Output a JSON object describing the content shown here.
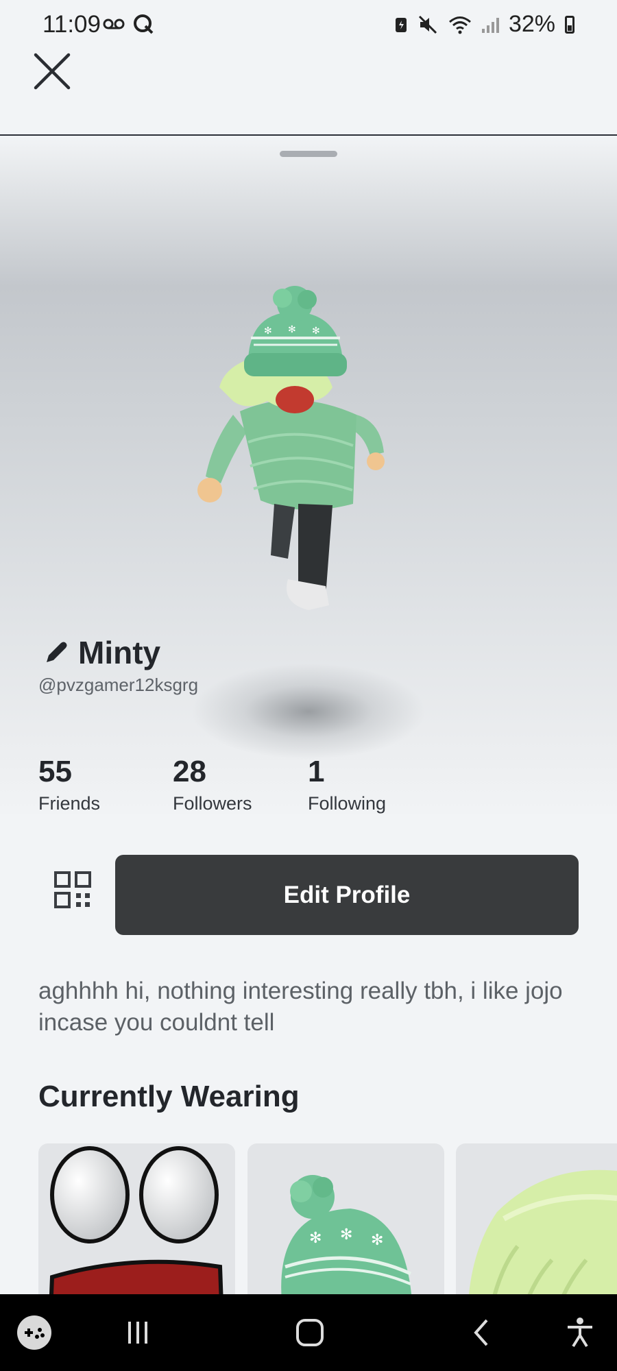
{
  "status_bar": {
    "time": "11:09",
    "battery": "32%"
  },
  "profile": {
    "display_name": "Minty",
    "username": "@pvzgamer12ksgrg",
    "bio": "aghhhh hi, nothing interesting really tbh, i like jojo incase you couldnt tell"
  },
  "stats": [
    {
      "value": "55",
      "label": "Friends"
    },
    {
      "value": "28",
      "label": "Followers"
    },
    {
      "value": "1",
      "label": "Following"
    }
  ],
  "actions": {
    "edit_profile": "Edit Profile"
  },
  "sections": {
    "currently_wearing": "Currently Wearing"
  },
  "wearing_items": [
    {
      "icon": "face-icon"
    },
    {
      "icon": "beanie-hat-icon"
    },
    {
      "icon": "hair-icon"
    }
  ],
  "colors": {
    "edit_button_bg": "#393b3d",
    "beanie_green": "#6fc296",
    "hair_green": "#d6eea8"
  }
}
